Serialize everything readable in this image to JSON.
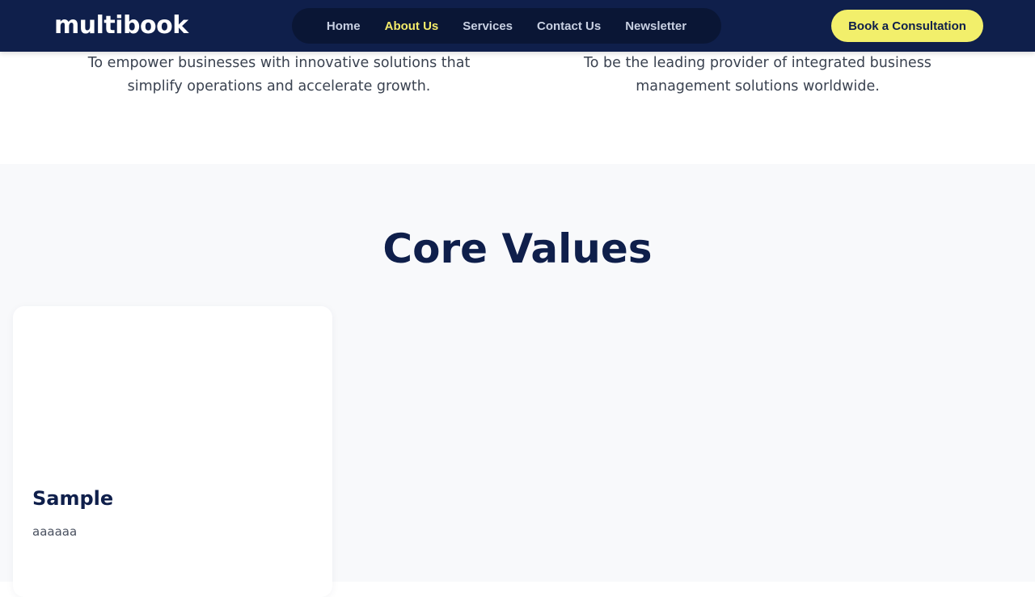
{
  "header": {
    "logo_text": "multibook",
    "nav": [
      {
        "label": "Home",
        "active": false
      },
      {
        "label": "About Us",
        "active": true
      },
      {
        "label": "Services",
        "active": false
      },
      {
        "label": "Contact Us",
        "active": false
      },
      {
        "label": "Newsletter",
        "active": false
      }
    ],
    "cta_label": "Book a Consultation"
  },
  "mission_vision": {
    "mission_text": "To empower businesses with innovative solutions that simplify operations and accelerate growth.",
    "vision_text": "To be the leading provider of integrated business management solutions worldwide."
  },
  "core_values": {
    "title": "Core Values",
    "cards": [
      {
        "title": "Sample",
        "description": "aaaaaa"
      }
    ]
  },
  "colors": {
    "navy": "#0f1f4b",
    "nav_pill": "#0a1635",
    "accent_yellow": "#f2ef6b",
    "active_nav": "#f3eb6a",
    "section_bg": "#f8f9fb"
  }
}
